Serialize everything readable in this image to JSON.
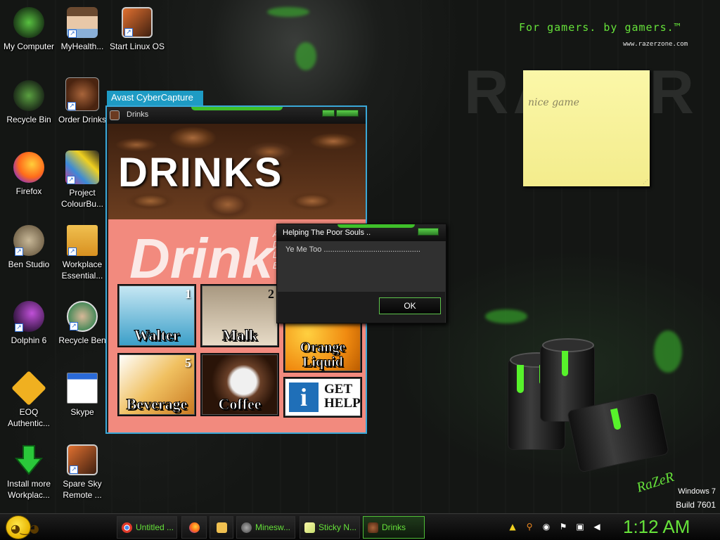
{
  "wallpaper": {
    "tagline": "For gamers. by gamers.™",
    "site": "www.razerzone.com",
    "watermark": "RAZER",
    "corner_logo": "RaZeR",
    "os_name": "Windows 7",
    "os_build": "Build 7601",
    "accent": "#66e23a"
  },
  "desktop_icons": [
    {
      "label": "My Computer",
      "icon": "computer-icon"
    },
    {
      "label": "MyHealth...",
      "icon": "avatar-icon"
    },
    {
      "label": "Start Linux OS",
      "icon": "vm-icon"
    },
    {
      "label": "Recycle Bin",
      "icon": "recycle-bin-icon"
    },
    {
      "label": "Order Drinks",
      "icon": "coffee-bean-icon"
    },
    {
      "label": "Firefox",
      "icon": "firefox-icon"
    },
    {
      "label": "Project ColourBu...",
      "icon": "collage-icon"
    },
    {
      "label": "Ben Studio",
      "icon": "cat-icon"
    },
    {
      "label": "Workplace Essential...",
      "icon": "folder-icon"
    },
    {
      "label": "Dolphin 6",
      "icon": "dolphin-icon"
    },
    {
      "label": "Recycle Ben",
      "icon": "face-icon"
    },
    {
      "label": "EOQ Authentic...",
      "icon": "key-icon"
    },
    {
      "label": "Skype",
      "icon": "window-icon"
    },
    {
      "label": "Install more Workplac...",
      "icon": "download-arrow-icon"
    },
    {
      "label": "Spare Sky Remote ...",
      "icon": "vm-icon"
    }
  ],
  "sticky_note": {
    "text": "nice game"
  },
  "avast_tooltip": "Avast CyberCapture",
  "drinks_window": {
    "title": "Drinks",
    "banner_title": "DRINKS",
    "big_word": "Drink",
    "tiles": [
      {
        "num": "1",
        "caption": "Walter",
        "color": "#3a9ec8"
      },
      {
        "num": "2",
        "caption": "Malk",
        "color": "#d8cfc0"
      },
      {
        "num": "",
        "caption": "Orange Liquid",
        "color": "#f39a1a"
      },
      {
        "num": "5",
        "caption": "Beverage",
        "color": "#e0a040"
      },
      {
        "num": "",
        "caption": "Coffee",
        "color": "#5a3320"
      }
    ],
    "help_tile": {
      "line1": "GET",
      "line2": "HELP",
      "icon": "info-icon"
    }
  },
  "dialog": {
    "title": "Helping The Poor Souls ..",
    "message": "Ye Me Too .............................................",
    "ok_label": "OK"
  },
  "taskbar": {
    "start": "start-orb-smiley",
    "buttons": [
      {
        "label": "Untitled ...",
        "icon": "chrome-icon",
        "active": false
      },
      {
        "label": "",
        "icon": "firefox-icon",
        "active": false
      },
      {
        "label": "",
        "icon": "folder-icon",
        "active": false
      },
      {
        "label": "Minesw...",
        "icon": "gear-icon",
        "active": false
      },
      {
        "label": "Sticky N...",
        "icon": "sticky-note-icon",
        "active": false
      },
      {
        "label": "Drinks",
        "icon": "coffee-bean-icon",
        "active": true
      }
    ],
    "clock": "1:12 AM"
  }
}
